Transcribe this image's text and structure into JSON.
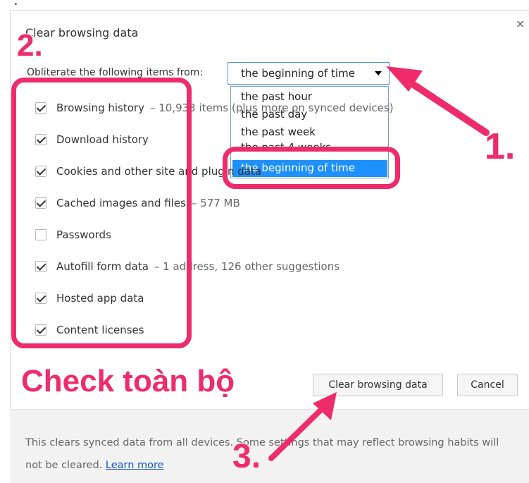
{
  "dialog": {
    "title": "Clear browsing data",
    "close_glyph": "×",
    "obliterate_label": "Obliterate the following items from:",
    "time_range": {
      "selected": "the beginning of time",
      "options": [
        "the past hour",
        "the past day",
        "the past week",
        "the past 4 weeks",
        "the beginning of time"
      ]
    },
    "items": [
      {
        "label": "Browsing history",
        "checked": true,
        "extra": "– 10,933 items (plus more on synced devices)"
      },
      {
        "label": "Download history",
        "checked": true,
        "extra": ""
      },
      {
        "label": "Cookies and other site and plugin data",
        "checked": true,
        "extra": ""
      },
      {
        "label": "Cached images and files",
        "checked": true,
        "extra": "– 577 MB"
      },
      {
        "label": "Passwords",
        "checked": false,
        "extra": ""
      },
      {
        "label": "Autofill form data",
        "checked": true,
        "extra": "– 1 address, 126 other suggestions"
      },
      {
        "label": "Hosted app data",
        "checked": true,
        "extra": ""
      },
      {
        "label": "Content licenses",
        "checked": true,
        "extra": ""
      }
    ],
    "buttons": {
      "clear": "Clear browsing data",
      "cancel": "Cancel"
    },
    "footer": {
      "text": "This clears synced data from all devices. Some settings that may reflect browsing habits will not be cleared.",
      "link": "Learn more"
    }
  },
  "annotations": {
    "step1": "1.",
    "step2": "2.",
    "step3": "3.",
    "caption": "Check toàn bộ",
    "accent_color": "#ee2c6c"
  }
}
